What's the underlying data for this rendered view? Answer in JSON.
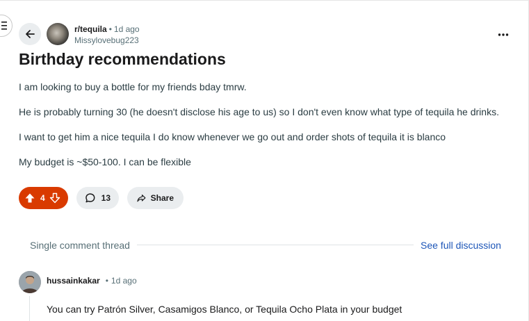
{
  "post": {
    "subreddit": "r/tequila",
    "separator": "•",
    "time_ago": "1d ago",
    "author": "Missylovebug223",
    "title": "Birthday recommendations",
    "body": [
      "I am looking to buy a bottle for my friends bday tmrw.",
      "He is probably turning 30 (he doesn't disclose his age to us) so I don't even know what type of tequila he drinks.",
      "I want to get him a nice tequila I do know whenever we go out and order shots of tequila it is blanco",
      "My budget is ~$50-100. I can be flexible"
    ]
  },
  "actions": {
    "vote_count": "4",
    "comment_count": "13",
    "share_label": "Share",
    "upvote_icon": "upvote-arrow-icon",
    "downvote_icon": "downvote-arrow-icon",
    "comment_icon": "comment-bubble-icon",
    "share_icon": "share-arrow-icon"
  },
  "thread": {
    "label": "Single comment thread",
    "full_discussion_link": "See full discussion"
  },
  "comment": {
    "author": "hussainkakar",
    "separator": "•",
    "time_ago": "1d ago",
    "text": "You can try Patrón Silver, Casamigos Blanco, or Tequila Ocho Plata in your budget"
  },
  "icons": {
    "menu": "hamburger-menu-icon",
    "back": "back-arrow-icon",
    "more": "more-options-icon"
  },
  "colors": {
    "accent_vote": "#d93a00",
    "pill_background": "#eaedef",
    "link": "#1d56b8",
    "meta_text": "#576f76"
  }
}
